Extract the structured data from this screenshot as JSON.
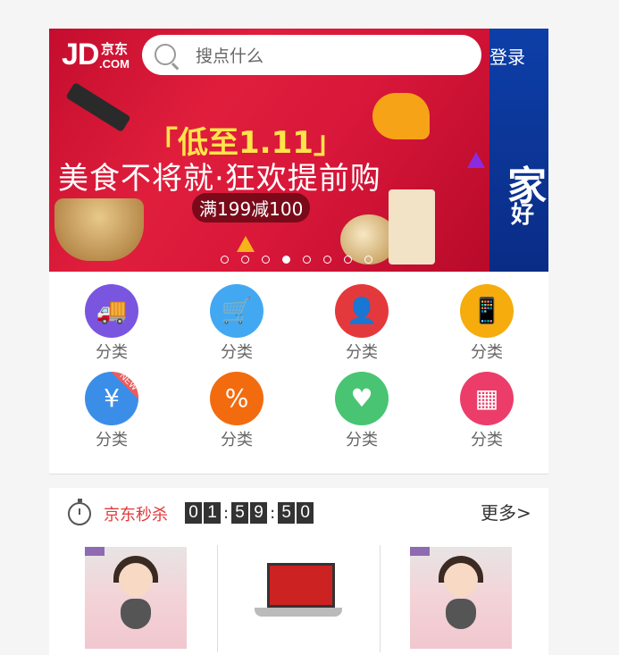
{
  "header": {
    "logo_text": "JD",
    "logo_cn": "京东",
    "logo_com": ".COM",
    "search_placeholder": "搜点什么",
    "login_label": "登录"
  },
  "banner": {
    "promo_title": "「低至1.11」",
    "promo_subtitle": "美食不将就·狂欢提前购",
    "promo_tag": "满199减100",
    "next_slide_big": "家",
    "next_slide_small": "好",
    "dots_count": 8,
    "active_dot": 3
  },
  "nav": {
    "items": [
      {
        "label": "分类",
        "icon": "truck-icon",
        "color": "#7a55e0"
      },
      {
        "label": "分类",
        "icon": "cart-icon",
        "color": "#43a8f2"
      },
      {
        "label": "分类",
        "icon": "user-icon",
        "color": "#e4393c"
      },
      {
        "label": "分类",
        "icon": "phone-recharge-icon",
        "color": "#f5ac0c"
      },
      {
        "label": "分类",
        "icon": "coupon-icon",
        "color": "#3b8ee8"
      },
      {
        "label": "分类",
        "icon": "tag-icon",
        "color": "#f26b0f"
      },
      {
        "label": "分类",
        "icon": "heart-icon",
        "color": "#49c472"
      },
      {
        "label": "分类",
        "icon": "apps-icon",
        "color": "#ec3d6a"
      }
    ],
    "coupon_badge": "NEW"
  },
  "seckill": {
    "title": "京东秒杀",
    "timer": {
      "h1": "0",
      "h2": "1",
      "m1": "5",
      "m2": "9",
      "s1": "5",
      "s2": "0"
    },
    "more_label": "更多>",
    "products": [
      {
        "name": "pajama-product",
        "image": "pajama"
      },
      {
        "name": "laptop-product",
        "image": "laptop"
      },
      {
        "name": "pajama-product",
        "image": "pajama"
      }
    ]
  }
}
